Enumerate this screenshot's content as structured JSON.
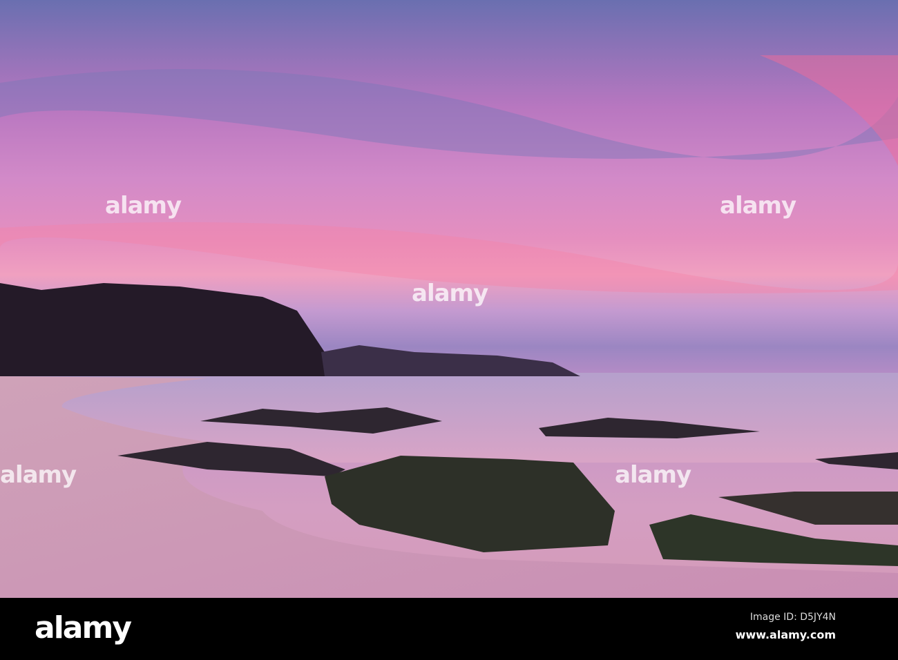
{
  "photo": {
    "subject": "pink sunset over rocky beach",
    "watermark": "alamy"
  },
  "footer": {
    "logo": "alamy",
    "image_id": "Image ID: D5JY4N",
    "website": "www.alamy.com"
  },
  "colors": {
    "sky_pink": "#e58fbf",
    "sky_blue": "#6a6fb0",
    "sand": "#d49ec2",
    "bar": "#000000"
  }
}
